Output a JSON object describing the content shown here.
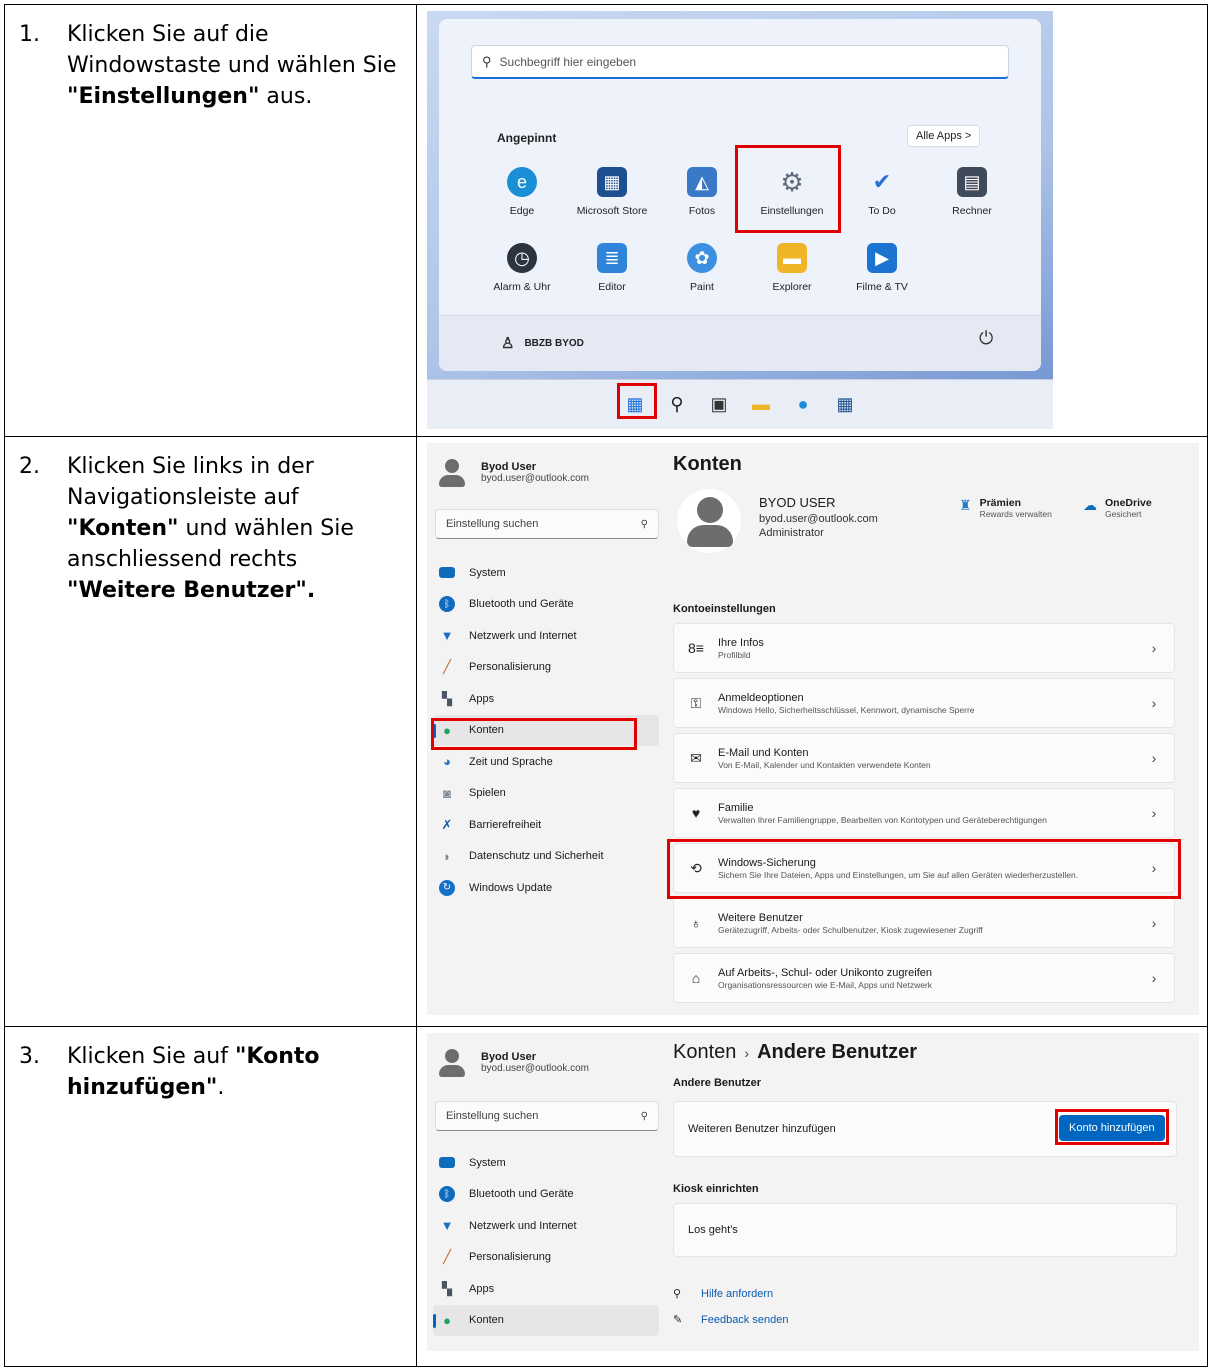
{
  "steps": [
    {
      "num": "1.",
      "text_parts": [
        "Klicken Sie auf die Windowstaste und wählen Sie ",
        "\"Einstellungen\"",
        " aus."
      ]
    },
    {
      "num": "2.",
      "text_parts": [
        "Klicken Sie links in der Navigationsleiste auf ",
        "\"Konten\"",
        " und wählen Sie anschliessend rechts ",
        "\"Weitere Benutzer\"."
      ]
    },
    {
      "num": "3.",
      "text_parts": [
        "Klicken Sie auf ",
        "\"Konto hinzufügen\"",
        "."
      ]
    }
  ],
  "start_menu": {
    "search_placeholder": "Suchbegriff hier eingeben",
    "pinned_label": "Angepinnt",
    "all_apps_label": "Alle Apps  >",
    "apps": [
      {
        "label": "Edge",
        "icon": "edge-icon",
        "color": "#1b8fd6"
      },
      {
        "label": "Microsoft Store",
        "icon": "store-icon",
        "color": "#1d4f91"
      },
      {
        "label": "Fotos",
        "icon": "photos-icon",
        "color": "#3a78c8"
      },
      {
        "label": "Einstellungen",
        "icon": "gear-icon",
        "color": "#5f6b7a"
      },
      {
        "label": "To Do",
        "icon": "todo-icon",
        "color": "#2f6fd1"
      },
      {
        "label": "Rechner",
        "icon": "calculator-icon",
        "color": "#3f4a5a"
      },
      {
        "label": "Alarm & Uhr",
        "icon": "clock-icon",
        "color": "#2d3440"
      },
      {
        "label": "Editor",
        "icon": "notepad-icon",
        "color": "#2f84d9"
      },
      {
        "label": "Paint",
        "icon": "palette-icon",
        "color": "#3d8fe0"
      },
      {
        "label": "Explorer",
        "icon": "folder-icon",
        "color": "#f0b429"
      },
      {
        "label": "Filme & TV",
        "icon": "film-icon",
        "color": "#1a74d0"
      }
    ],
    "user_label": "BBZB BYOD",
    "power_glyph": "⏻"
  },
  "settings": {
    "user_name": "Byod User",
    "user_mail": "byod.user@outlook.com",
    "search_placeholder": "Einstellung suchen",
    "nav": [
      {
        "label": "System",
        "icon": "system-icon",
        "color": "#0f6cbd"
      },
      {
        "label": "Bluetooth und Geräte",
        "icon": "bluetooth-icon",
        "color": "#0f6cbd"
      },
      {
        "label": "Netzwerk und Internet",
        "icon": "wifi-icon",
        "color": "#1c6ec8"
      },
      {
        "label": "Personalisierung",
        "icon": "brush-icon",
        "color": "#c1662b"
      },
      {
        "label": "Apps",
        "icon": "apps-icon",
        "color": "#4b5665"
      },
      {
        "label": "Konten",
        "icon": "person-icon",
        "color": "#1ea35f"
      },
      {
        "label": "Zeit und Sprache",
        "icon": "globe-clock-icon",
        "color": "#2a78c8"
      },
      {
        "label": "Spielen",
        "icon": "gamepad-icon",
        "color": "#7c8794"
      },
      {
        "label": "Barrierefreiheit",
        "icon": "accessibility-icon",
        "color": "#1a5fb4"
      },
      {
        "label": "Datenschutz und Sicherheit",
        "icon": "shield-icon",
        "color": "#7b8591"
      },
      {
        "label": "Windows Update",
        "icon": "update-icon",
        "color": "#1570c9"
      }
    ],
    "konten_title": "Konten",
    "account_name": "BYOD USER",
    "account_mail": "byod.user@outlook.com",
    "account_role": "Administrator",
    "tile_rewards_title": "Prämien",
    "tile_rewards_sub": "Rewards verwalten",
    "tile_onedrive_title": "OneDrive",
    "tile_onedrive_sub": "Gesichert",
    "section_heading": "Kontoeinstellungen",
    "cards": [
      {
        "title": "Ihre Infos",
        "sub": "Profilbild",
        "icon": "info-icon"
      },
      {
        "title": "Anmeldeoptionen",
        "sub": "Windows Hello, Sicherheitsschlüssel, Kennwort, dynamische Sperre",
        "icon": "key-icon"
      },
      {
        "title": "E-Mail und Konten",
        "sub": "Von E-Mail, Kalender und Kontakten verwendete Konten",
        "icon": "mail-icon"
      },
      {
        "title": "Familie",
        "sub": "Verwalten Ihrer Familiengruppe, Bearbeiten von Kontotypen und Geräteberechtigungen",
        "icon": "family-icon"
      },
      {
        "title": "Windows-Sicherung",
        "sub": "Sichern Sie Ihre Dateien, Apps und Einstellungen, um Sie auf allen Geräten wiederherzustellen.",
        "icon": "backup-icon"
      },
      {
        "title": "Weitere Benutzer",
        "sub": "Gerätezugriff, Arbeits- oder Schulbenutzer, Kiosk zugewiesener Zugriff",
        "icon": "add-user-icon"
      },
      {
        "title": "Auf Arbeits-, Schul- oder Unikonto zugreifen",
        "sub": "Organisationsressourcen wie E-Mail, Apps und Netzwerk",
        "icon": "briefcase-icon"
      }
    ],
    "chevron": "›"
  },
  "others": {
    "breadcrumb_root": "Konten",
    "breadcrumb_sep": "›",
    "breadcrumb_current": "Andere Benutzer",
    "section1": "Andere Benutzer",
    "add_row_label": "Weiteren Benutzer hinzufügen",
    "add_button": "Konto hinzufügen",
    "section2": "Kiosk einrichten",
    "kiosk_row": "Los geht's",
    "help_link": "Hilfe anfordern",
    "feedback_link": "Feedback senden"
  },
  "accent_red": "#e10000",
  "accent_blue": "#0067c0"
}
